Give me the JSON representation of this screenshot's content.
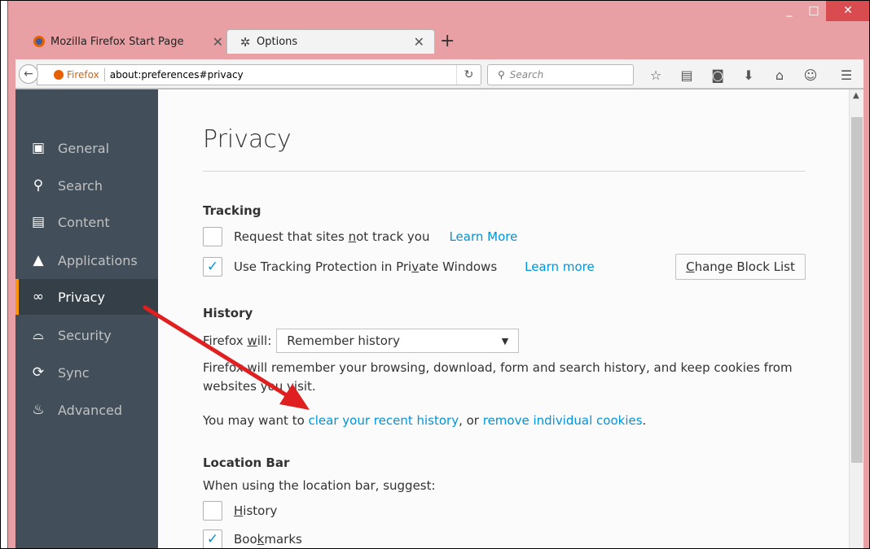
{
  "tabs": [
    {
      "title": "Mozilla Firefox Start Page",
      "icon": "firefox-icon"
    },
    {
      "title": "Options",
      "icon": "gear-icon"
    }
  ],
  "newtab_label": "+",
  "window_controls": {
    "minimize": "_",
    "maximize": "□",
    "close": "✕"
  },
  "navbar": {
    "identity": "Firefox",
    "url": "about:preferences#privacy",
    "search_placeholder": "Search"
  },
  "sidebar": {
    "items": [
      {
        "label": "General",
        "icon": "general-icon"
      },
      {
        "label": "Search",
        "icon": "search-icon"
      },
      {
        "label": "Content",
        "icon": "content-icon"
      },
      {
        "label": "Applications",
        "icon": "applications-icon"
      },
      {
        "label": "Privacy",
        "icon": "privacy-mask-icon",
        "selected": true
      },
      {
        "label": "Security",
        "icon": "security-icon"
      },
      {
        "label": "Sync",
        "icon": "sync-icon"
      },
      {
        "label": "Advanced",
        "icon": "advanced-icon"
      }
    ]
  },
  "main": {
    "title": "Privacy",
    "tracking": {
      "heading": "Tracking",
      "dnt_label_a": "Request that sites ",
      "dnt_label_u": "n",
      "dnt_label_b": "ot track you",
      "dnt_link": "Learn More",
      "tp_label_a": "Use Tracking Protection in Pri",
      "tp_label_u": "v",
      "tp_label_b": "ate Windows",
      "tp_link": "Learn more",
      "change_block_list_u": "C",
      "change_block_list_rest": "hange Block List"
    },
    "history": {
      "heading": "History",
      "firefox_will_a": "Firefox ",
      "firefox_will_u": "w",
      "firefox_will_b": "ill:",
      "select_value": "Remember history",
      "description": "Firefox will remember your browsing, download, form and search history, and keep cookies from websites you visit.",
      "may_want_a": "You may want to ",
      "clear_link": "clear your recent history",
      "may_want_b": ", or ",
      "remove_link": "remove individual cookies",
      "may_want_c": "."
    },
    "location_bar": {
      "heading": "Location Bar",
      "suggest": "When using the location bar, suggest:",
      "history_u": "H",
      "history_rest": "istory",
      "bookmarks_a": "Boo",
      "bookmarks_u": "k",
      "bookmarks_b": "marks"
    }
  },
  "colors": {
    "accent": "#0095dd",
    "sidebar_bg": "#424f5a",
    "selected_marker": "#ff9500",
    "annotation_arrow": "#e02020"
  }
}
